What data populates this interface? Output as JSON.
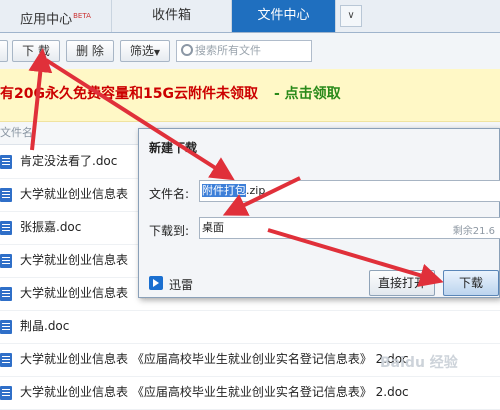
{
  "tabs": [
    {
      "label": "应用中心",
      "badge": "BETA"
    },
    {
      "label": "收件箱",
      "badge": ""
    },
    {
      "label": "文件中心",
      "badge": ""
    }
  ],
  "toolbar": {
    "download_label": "下 载",
    "delete_label": "删 除",
    "filter_label": "筛选",
    "search_placeholder": "搜索所有文件"
  },
  "notice": {
    "text": "有20G永久免费容量和15G云附件未领取",
    "link": "- 点击领取"
  },
  "list": {
    "header": "文件名",
    "files": [
      "肯定没法看了.doc",
      "大学就业创业信息表 《应",
      "张振嘉.doc",
      "大学就业创业信息表 《应",
      "大学就业创业信息表 《应",
      "荆晶.doc",
      "大学就业创业信息表 《应届高校毕业生就业创业实名登记信息表》 2.doc",
      "大学就业创业信息表 《应届高校毕业生就业创业实名登记信息表》 2.doc"
    ]
  },
  "dialog": {
    "title": "新建下载",
    "filename_label": "文件名:",
    "filename_selected": "附件打包",
    "filename_ext": ".zip",
    "saveto_label": "下载到:",
    "saveto_value": "桌面",
    "space_text": "剩余21.6",
    "xunlei_label": "迅雷",
    "direct_open_label": "直接打开",
    "download_label": "下载"
  },
  "watermark": "Baidu 经验",
  "colors": {
    "active_tab": "#1f6fbf",
    "notice_bg": "#fff8c6",
    "notice_red": "#cc0000",
    "notice_green": "#2a8a1a",
    "arrow": "#e0303a"
  }
}
